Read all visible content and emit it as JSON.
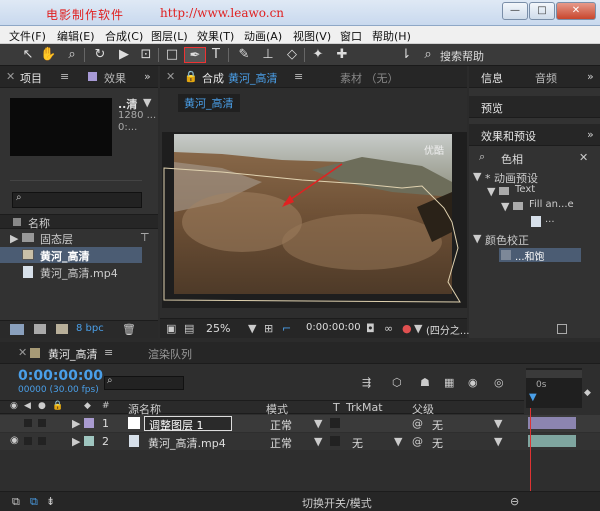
{
  "titlebar": {
    "title": "电影制作软件",
    "url": "http://www.leawo.cn",
    "minimize": "—",
    "maximize": "□",
    "close": "✕"
  },
  "menu": [
    "文件(F)",
    "编辑(E)",
    "合成(C)",
    "图层(L)",
    "效果(T)",
    "动画(A)",
    "视图(V)",
    "窗口",
    "帮助(H)"
  ],
  "toolbar": {
    "search_label": "搜索帮助"
  },
  "project_panel": {
    "tab_label": "项目",
    "effects_tab": "效果",
    "comp_name": "..清",
    "comp_res": "1280 ...",
    "comp_dur": "0:...",
    "column_name": "名称",
    "items": [
      {
        "label": "固态层",
        "type": "folder"
      },
      {
        "label": "黄河_高清",
        "type": "comp"
      },
      {
        "label": "黄河_高清.mp4",
        "type": "footage"
      }
    ],
    "bpc": "8 bpc"
  },
  "comp_panel": {
    "tab_prefix": "合成",
    "tab_name": "黄河_高清",
    "footage_tab": "素材 （无）",
    "breadcrumb": "黄河_高清",
    "watermark": "优酷",
    "zoom": "25%",
    "timecode": "0:00:00:00",
    "quality": "(四分之..."
  },
  "right_panel": {
    "info_tab": "信息",
    "audio_tab": "音频",
    "preview_tab": "预览",
    "effects_tab": "效果和预设",
    "search_value": "色相",
    "tree": [
      {
        "label": "* 动画预设",
        "level": 0
      },
      {
        "label": "Text",
        "level": 1
      },
      {
        "label": "Fill an...e",
        "level": 2
      },
      {
        "label": "...",
        "level": 3
      },
      {
        "label": "颜色校正",
        "level": 0
      },
      {
        "label": "...和饱",
        "level": 1
      }
    ]
  },
  "timeline": {
    "tab_name": "黄河_高清",
    "render_queue": "渲染队列",
    "timecode": "0:00:00:00",
    "fps": "00000 (30.00 fps)",
    "columns": {
      "source": "源名称",
      "mode": "模式",
      "t": "T",
      "trkmat": "TrkMat",
      "parent": "父级"
    },
    "layers": [
      {
        "num": "1",
        "name": "调整图层 1",
        "mode": "正常",
        "trkmat": "",
        "parent": "无"
      },
      {
        "num": "2",
        "name": "黄河_高清.mp4",
        "mode": "正常",
        "trkmat": "无",
        "parent": "无"
      }
    ],
    "ruler_label": "0s",
    "footer": "切换开关/模式"
  },
  "colors": {
    "accent_blue": "#4a9fe8",
    "selection_red": "#e33333",
    "panel_bg": "#323232"
  }
}
